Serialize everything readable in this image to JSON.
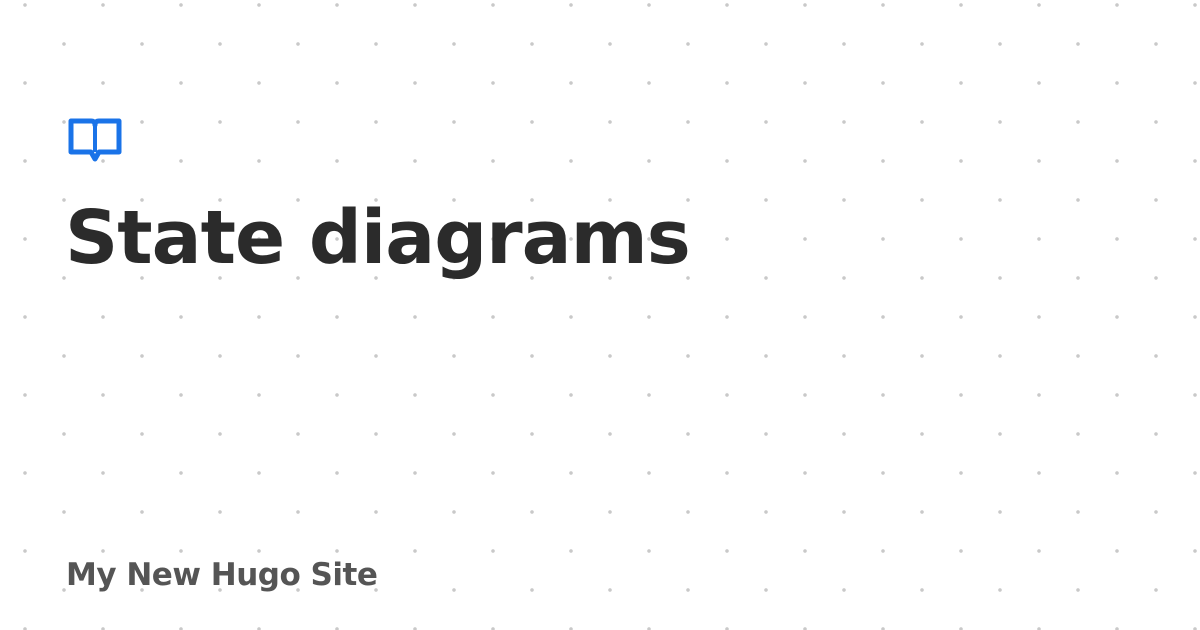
{
  "card": {
    "icon": "book-open-icon",
    "title": "State diagrams",
    "site_name": "My New Hugo Site"
  },
  "colors": {
    "accent": "#1a73e8",
    "title": "#2b2b2b",
    "site_name": "#555555",
    "dot": "#c9c9c9",
    "background": "#ffffff"
  }
}
